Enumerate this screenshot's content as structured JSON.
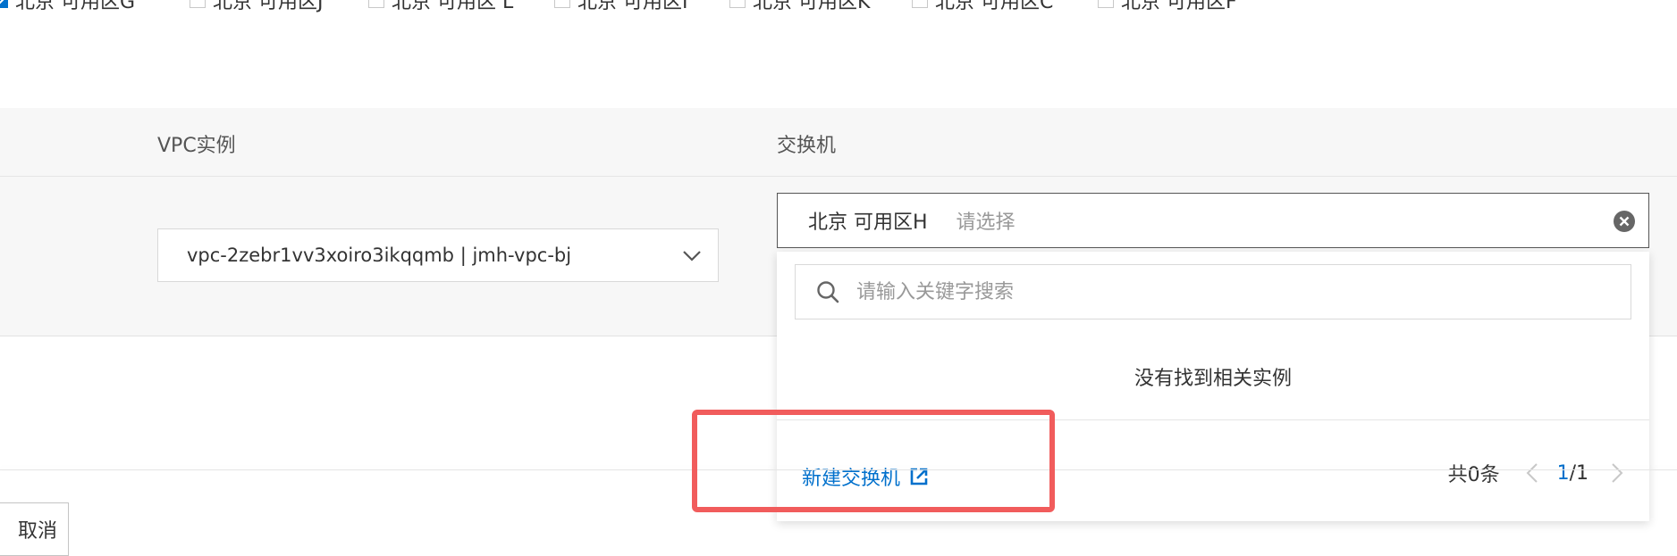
{
  "zones": [
    {
      "label": "北京 可用区G",
      "checked": true
    },
    {
      "label": "北京 可用区J",
      "checked": false
    },
    {
      "label": "北京 可用区 L",
      "checked": false
    },
    {
      "label": "北京 可用区I",
      "checked": false
    },
    {
      "label": "北京 可用区K",
      "checked": false
    },
    {
      "label": "北京 可用区C",
      "checked": false
    },
    {
      "label": "北京 可用区F",
      "checked": false
    }
  ],
  "table": {
    "headers": {
      "vpc": "VPC实例",
      "switch": "交换机"
    }
  },
  "vpc": {
    "value": "vpc-2zebr1vv3xoiro3ikqqmb | jmh-vpc-bj",
    "arrow_icon": "chevron-down-icon"
  },
  "vswitch": {
    "zone_prefix": "北京 可用区H",
    "placeholder": "请选择",
    "clear_icon": "clear-circle-icon"
  },
  "dropdown": {
    "search_placeholder": "请输入关键字搜索",
    "empty_text": "没有找到相关实例",
    "create_link": "新建交换机",
    "total": "共0条",
    "page_current": "1",
    "page_sep_total": "/1"
  },
  "footer": {
    "cancel_label": "取消"
  },
  "colors": {
    "accent": "#0070cc",
    "highlight": "#f15c5c"
  }
}
